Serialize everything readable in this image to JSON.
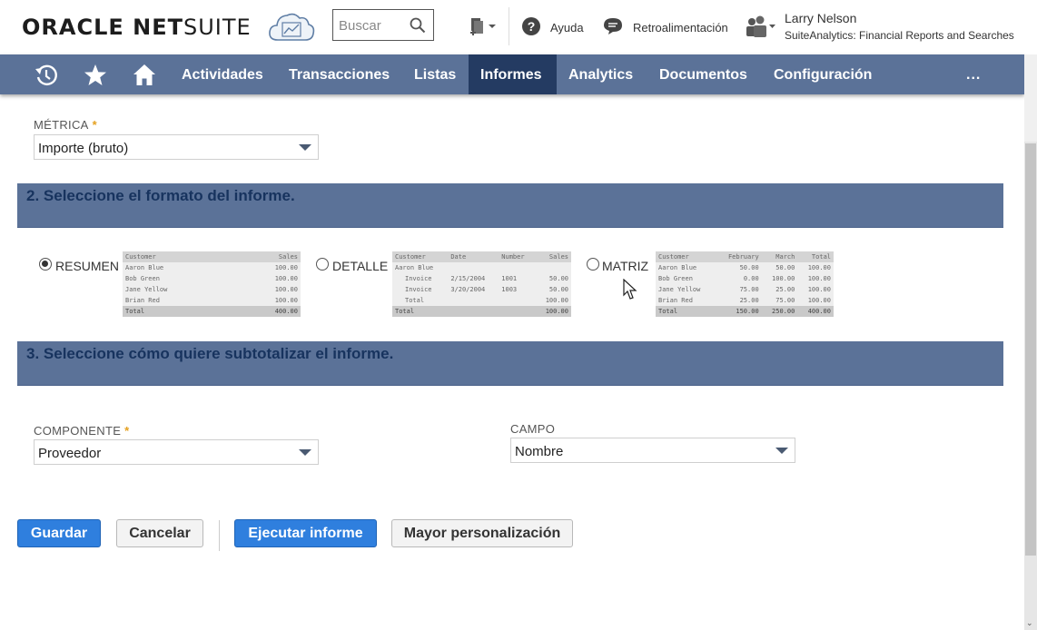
{
  "header": {
    "logo_bold": "ORACLE NET",
    "logo_thin": "SUITE",
    "search_placeholder": "Buscar",
    "help_label": "Ayuda",
    "feedback_label": "Retroalimentación",
    "user_name": "Larry Nelson",
    "user_role": "SuiteAnalytics: Financial Reports and Searches"
  },
  "nav": {
    "items": [
      "Actividades",
      "Transacciones",
      "Listas",
      "Informes",
      "Analytics",
      "Documentos",
      "Configuración"
    ],
    "active": "Informes",
    "more": "..."
  },
  "metric": {
    "label": "MÉTRICA",
    "required_mark": "*",
    "value": "Importe (bruto)"
  },
  "section2": {
    "title": "2. Seleccione el formato del informe.",
    "options": [
      {
        "label": "RESUMEN",
        "checked": true
      },
      {
        "label": "DETALLE",
        "checked": false
      },
      {
        "label": "MATRIZ",
        "checked": false
      }
    ],
    "summary_table": {
      "headers": [
        "Customer",
        "Sales"
      ],
      "rows": [
        [
          "Aaron Blue",
          "100.00"
        ],
        [
          "Bob Green",
          "100.00"
        ],
        [
          "Jane Yellow",
          "100.00"
        ],
        [
          "Brian Red",
          "100.00"
        ]
      ],
      "total": [
        "Total",
        "400.00"
      ]
    },
    "detail_table": {
      "headers": [
        "Customer",
        "Date",
        "Number",
        "Sales"
      ],
      "rows": [
        [
          "Aaron Blue",
          "",
          "",
          ""
        ],
        [
          "Invoice",
          "2/15/2004",
          "1001",
          "50.00"
        ],
        [
          "Invoice",
          "3/20/2004",
          "1003",
          "50.00"
        ],
        [
          "Total",
          "",
          "",
          "100.00"
        ]
      ],
      "total": [
        "Total",
        "",
        "",
        "100.00"
      ]
    },
    "matrix_table": {
      "headers": [
        "Customer",
        "February",
        "March",
        "Total"
      ],
      "rows": [
        [
          "Aaron Blue",
          "50.00",
          "50.00",
          "100.00"
        ],
        [
          "Bob Green",
          "0.00",
          "100.00",
          "100.00"
        ],
        [
          "Jane Yellow",
          "75.00",
          "25.00",
          "100.00"
        ],
        [
          "Brian Red",
          "25.00",
          "75.00",
          "100.00"
        ]
      ],
      "total": [
        "Total",
        "150.00",
        "250.00",
        "400.00"
      ]
    }
  },
  "section3": {
    "title": "3. Seleccione cómo quiere subtotalizar el informe.",
    "component_label": "COMPONENTE",
    "component_required": "*",
    "component_value": "Proveedor",
    "field_label": "CAMPO",
    "field_value": "Nombre"
  },
  "buttons": {
    "save": "Guardar",
    "cancel": "Cancelar",
    "run": "Ejecutar informe",
    "customize": "Mayor personalización"
  },
  "colors": {
    "nav_bg": "#5b7298",
    "nav_active": "#243b62",
    "section_title": "#17335e",
    "primary_button": "#2f7fde"
  }
}
